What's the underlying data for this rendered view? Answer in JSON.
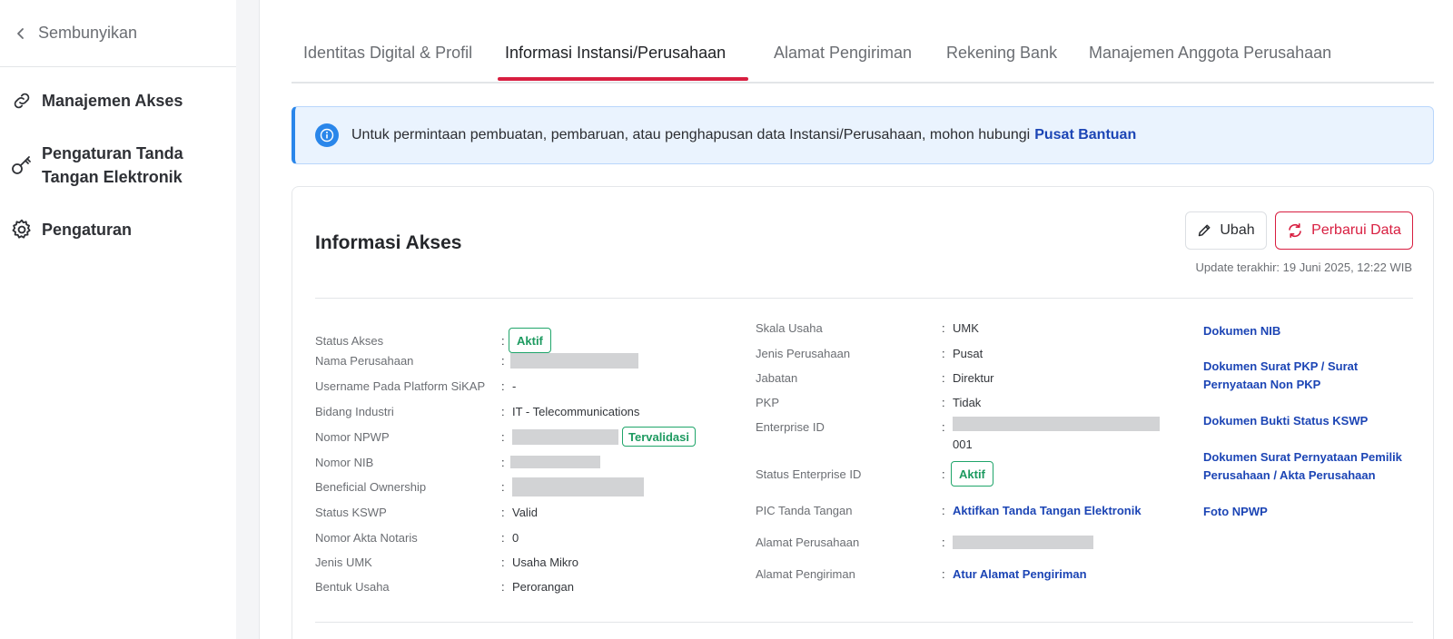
{
  "sidebar": {
    "hide_label": "Sembunyikan",
    "items": [
      {
        "label": "Manajemen Akses",
        "icon": "link-icon"
      },
      {
        "label": "Pengaturan Tanda Tangan Elektronik",
        "icon": "key-icon"
      },
      {
        "label": "Pengaturan",
        "icon": "gear-icon"
      }
    ]
  },
  "tabs": [
    {
      "label": "Identitas Digital & Profil",
      "active": false
    },
    {
      "label": "Informasi Instansi/Perusahaan",
      "active": true
    },
    {
      "label": "Alamat Pengiriman",
      "active": false
    },
    {
      "label": "Rekening Bank",
      "active": false
    },
    {
      "label": "Manajemen Anggota Perusahaan",
      "active": false
    }
  ],
  "banner": {
    "text": "Untuk permintaan pembuatan, pembaruan, atau penghapusan data Instansi/Perusahaan, mohon hubungi",
    "link": "Pusat Bantuan"
  },
  "card": {
    "title": "Informasi Akses",
    "edit_label": "Ubah",
    "refresh_label": "Perbarui Data",
    "updated": "Update terakhir: 19 Juni 2025, 12:22 WIB"
  },
  "left_fields": [
    {
      "label": "Status Akses",
      "value": "",
      "badge": "Aktif"
    },
    {
      "label": "Nama Perusahaan",
      "value": "",
      "redacted": true
    },
    {
      "label": "Username Pada Platform SiKAP",
      "value": "-"
    },
    {
      "label": "Bidang Industri",
      "value": "IT - Telecommunications"
    },
    {
      "label": "Nomor NPWP",
      "value": "",
      "redacted": true,
      "badge": "Tervalidasi"
    },
    {
      "label": "Nomor NIB",
      "value": "",
      "redacted": true
    },
    {
      "label": "Beneficial Ownership",
      "value": "",
      "redacted": true
    },
    {
      "label": "Status KSWP",
      "value": "Valid"
    },
    {
      "label": "Nomor Akta Notaris",
      "value": "0"
    },
    {
      "label": "Jenis UMK",
      "value": "Usaha Mikro"
    },
    {
      "label": "Bentuk Usaha",
      "value": "Perorangan"
    }
  ],
  "middle_fields": [
    {
      "label": "Skala Usaha",
      "value": "UMK"
    },
    {
      "label": "Jenis Perusahaan",
      "value": "Pusat"
    },
    {
      "label": "Jabatan",
      "value": "Direktur"
    },
    {
      "label": "PKP",
      "value": "Tidak"
    },
    {
      "label": "Enterprise ID",
      "value": "001",
      "redacted": true
    },
    {
      "label": "Status Enterprise ID",
      "value": "",
      "badge": "Aktif"
    },
    {
      "label": "PIC Tanda Tangan",
      "value": "Aktifkan Tanda Tangan Elektronik",
      "link": true
    },
    {
      "label": "Alamat Perusahaan",
      "value": "",
      "redacted": true
    },
    {
      "label": "Alamat Pengiriman",
      "value": "Atur Alamat Pengiriman",
      "link": true
    }
  ],
  "documents": [
    "Dokumen NIB",
    "Dokumen Surat PKP / Surat Pernyataan Non PKP",
    "Dokumen Bukti Status KSWP",
    "Dokumen Surat Pernyataan Pemilik Perusahaan / Akta Perusahaan",
    "Foto NPWP"
  ],
  "colors": {
    "accent": "#d81e40",
    "link": "#1c45b5",
    "success": "#1d9a60",
    "info": "#2a86ea"
  }
}
